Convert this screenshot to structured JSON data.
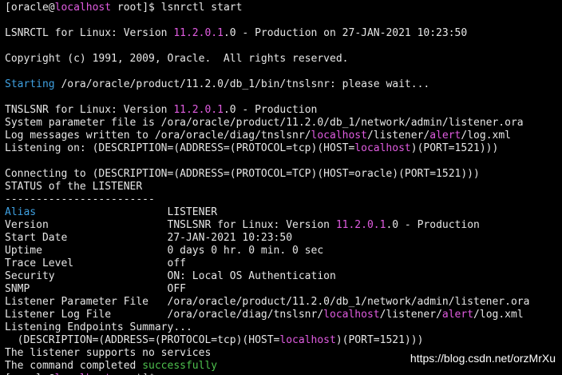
{
  "terminal": {
    "lines": [
      [
        {
          "t": "[oracle@"
        },
        {
          "t": "localhost",
          "c": "magenta"
        },
        {
          "t": " root]$ lsnrctl start"
        }
      ],
      [],
      [
        {
          "t": "LSNRCTL for Linux: Version "
        },
        {
          "t": "11.2.0.1",
          "c": "magenta"
        },
        {
          "t": ".0 - Production on 27-JAN-2021 10:23:50"
        }
      ],
      [],
      [
        {
          "t": "Copyright (c) 1991, 2009, Oracle.  All rights reserved."
        }
      ],
      [],
      [
        {
          "t": "Starting",
          "c": "blue"
        },
        {
          "t": " /ora/oracle/product/11.2.0/db_1/bin/tnslsnr: please wait..."
        }
      ],
      [],
      [
        {
          "t": "TNSLSNR for Linux: Version "
        },
        {
          "t": "11.2.0.1",
          "c": "magenta"
        },
        {
          "t": ".0 - Production"
        }
      ],
      [
        {
          "t": "System parameter file is /ora/oracle/product/11.2.0/db_1/network/admin/listener.ora"
        }
      ],
      [
        {
          "t": "Log messages written to /ora/oracle/diag/tnslsnr/"
        },
        {
          "t": "localhost",
          "c": "magenta"
        },
        {
          "t": "/listener/"
        },
        {
          "t": "alert",
          "c": "magenta"
        },
        {
          "t": "/log.xml"
        }
      ],
      [
        {
          "t": "Listening on: (DESCRIPTION=(ADDRESS=(PROTOCOL=tcp)(HOST="
        },
        {
          "t": "localhost",
          "c": "magenta"
        },
        {
          "t": ")(PORT=1521)))"
        }
      ],
      [],
      [
        {
          "t": "Connecting to (DESCRIPTION=(ADDRESS=(PROTOCOL=TCP)(HOST=oracle)(PORT=1521)))"
        }
      ],
      [
        {
          "t": "STATUS of the LISTENER"
        }
      ],
      [
        {
          "t": "------------------------"
        }
      ],
      [
        {
          "t": "Alias",
          "c": "blue"
        },
        {
          "t": "                     LISTENER"
        }
      ],
      [
        {
          "t": "Version                   TNSLSNR for Linux: Version "
        },
        {
          "t": "11.2.0.1",
          "c": "magenta"
        },
        {
          "t": ".0 - Production"
        }
      ],
      [
        {
          "t": "Start Date                27-JAN-2021 10:23:50"
        }
      ],
      [
        {
          "t": "Uptime                    0 days 0 hr. 0 min. 0 sec"
        }
      ],
      [
        {
          "t": "Trace Level               off"
        }
      ],
      [
        {
          "t": "Security                  ON: Local OS Authentication"
        }
      ],
      [
        {
          "t": "SNMP                      OFF"
        }
      ],
      [
        {
          "t": "Listener Parameter File   /ora/oracle/product/11.2.0/db_1/network/admin/listener.ora"
        }
      ],
      [
        {
          "t": "Listener Log File         /ora/oracle/diag/tnslsnr/"
        },
        {
          "t": "localhost",
          "c": "magenta"
        },
        {
          "t": "/listener/"
        },
        {
          "t": "alert",
          "c": "magenta"
        },
        {
          "t": "/log.xml"
        }
      ],
      [
        {
          "t": "Listening Endpoints Summary..."
        }
      ],
      [
        {
          "t": "  (DESCRIPTION=(ADDRESS=(PROTOCOL=tcp)(HOST="
        },
        {
          "t": "localhost",
          "c": "magenta"
        },
        {
          "t": ")(PORT=1521)))"
        }
      ],
      [
        {
          "t": "The listener supports no services"
        }
      ],
      [
        {
          "t": "The command completed "
        },
        {
          "t": "successfully",
          "c": "green"
        }
      ],
      [
        {
          "t": "[oracle@"
        },
        {
          "t": "localhost",
          "c": "magenta"
        },
        {
          "t": " root]$",
          "c": "partial"
        }
      ]
    ]
  },
  "watermark": "https://blog.csdn.net/orzMrXu",
  "colors": {
    "background": "#000000",
    "text": "#e6e6e6",
    "magenta": "#e05ce0",
    "blue": "#3fa0e0",
    "green": "#4ec24e"
  }
}
